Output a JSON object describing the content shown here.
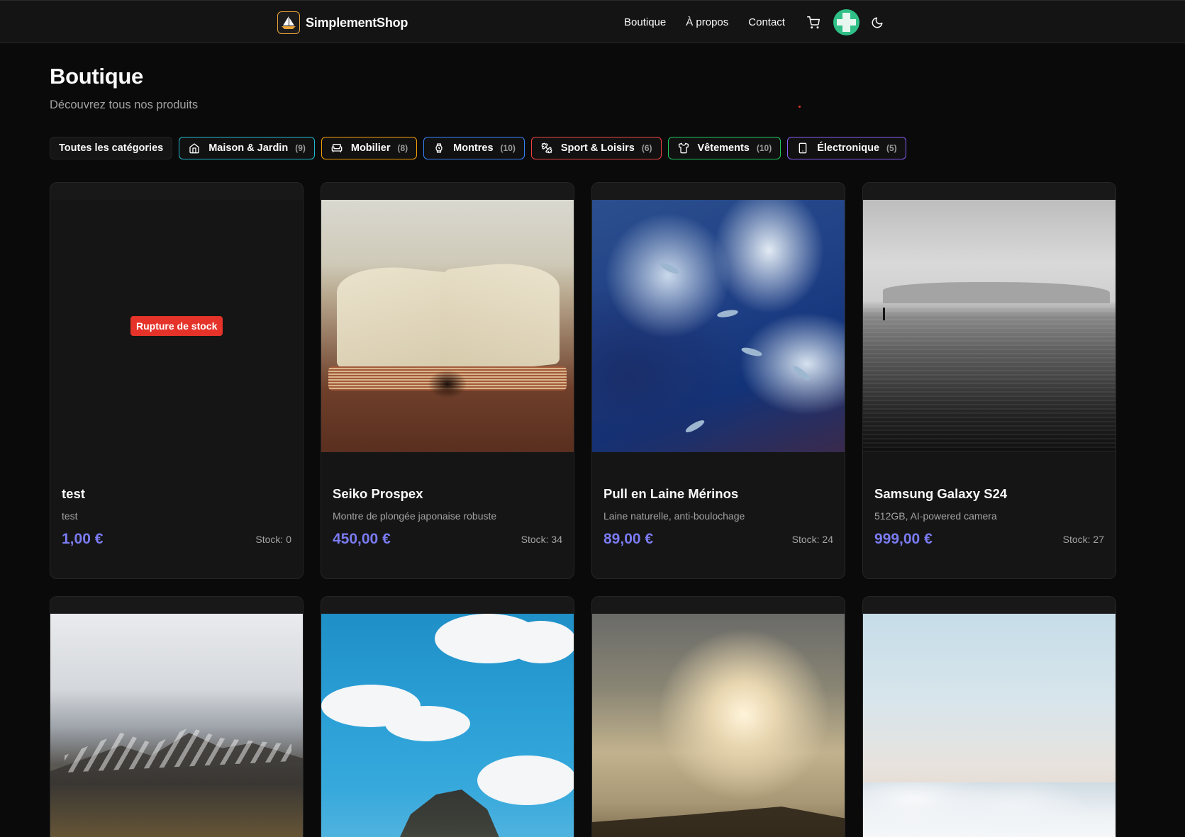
{
  "header": {
    "brand": "SimplementShop",
    "nav": [
      "Boutique",
      "À propos",
      "Contact"
    ],
    "icons": [
      "cart-icon",
      "avatar",
      "moon-icon"
    ]
  },
  "page": {
    "title": "Boutique",
    "subtitle": "Découvrez tous nos produits"
  },
  "filters": {
    "all_label": "Toutes les catégories",
    "categories": [
      {
        "label": "Maison & Jardin",
        "count": "(9)",
        "icon": "home-icon",
        "color": "#22b8cf"
      },
      {
        "label": "Mobilier",
        "count": "(8)",
        "icon": "sofa-icon",
        "color": "#f59f0b"
      },
      {
        "label": "Montres",
        "count": "(10)",
        "icon": "watch-icon",
        "color": "#3b82f6"
      },
      {
        "label": "Sport & Loisirs",
        "count": "(6)",
        "icon": "dumbbell-icon",
        "color": "#ef4444"
      },
      {
        "label": "Vêtements",
        "count": "(10)",
        "icon": "shirt-icon",
        "color": "#22c55e"
      },
      {
        "label": "Électronique",
        "count": "(5)",
        "icon": "smartphone-icon",
        "color": "#8b5cf6"
      }
    ]
  },
  "products": [
    {
      "name": "test",
      "desc": "test",
      "price": "1,00 €",
      "stock": "Stock: 0",
      "badge": "Rupture de stock"
    },
    {
      "name": "Seiko Prospex",
      "desc": "Montre de plongée japonaise robuste",
      "price": "450,00 €",
      "stock": "Stock: 34"
    },
    {
      "name": "Pull en Laine Mérinos",
      "desc": "Laine naturelle, anti-boulochage",
      "price": "89,00 €",
      "stock": "Stock: 24"
    },
    {
      "name": "Samsung Galaxy S24",
      "desc": "512GB, AI-powered camera",
      "price": "999,00 €",
      "stock": "Stock: 27"
    }
  ],
  "colors": {
    "accent_price": "#7b7bf2",
    "badge_out": "#e5332a",
    "background": "#0a0a0a"
  }
}
